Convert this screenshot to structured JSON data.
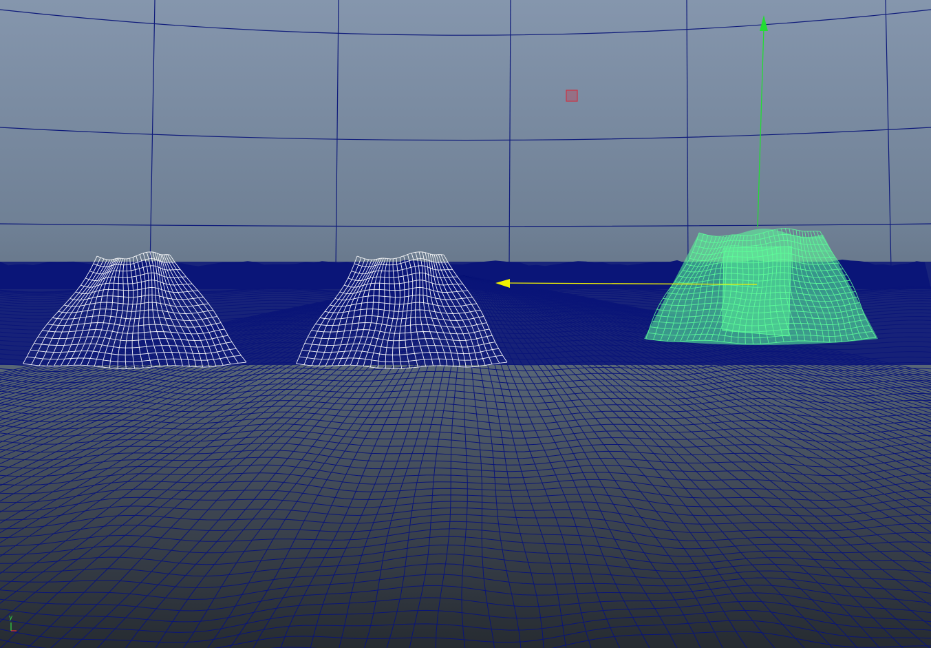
{
  "viewport": {
    "colors": {
      "grid_line": "#0e1a7a",
      "terrain_line": "#0a1578",
      "rock_unselected": "#ffffff",
      "rock_selected": "#5dff9a",
      "manip_y": "#22dd33",
      "manip_x": "#f2f200",
      "manip_center": "#cc3344"
    },
    "objects": [
      {
        "icon": "rock-mesh-icon",
        "selected": false
      },
      {
        "icon": "rock-mesh-icon",
        "selected": false
      },
      {
        "icon": "rock-mesh-icon",
        "selected": true
      }
    ]
  },
  "axis_gizmo": {
    "y_label": "y",
    "y_color": "#33dd44",
    "x_color": "#ee3333"
  }
}
